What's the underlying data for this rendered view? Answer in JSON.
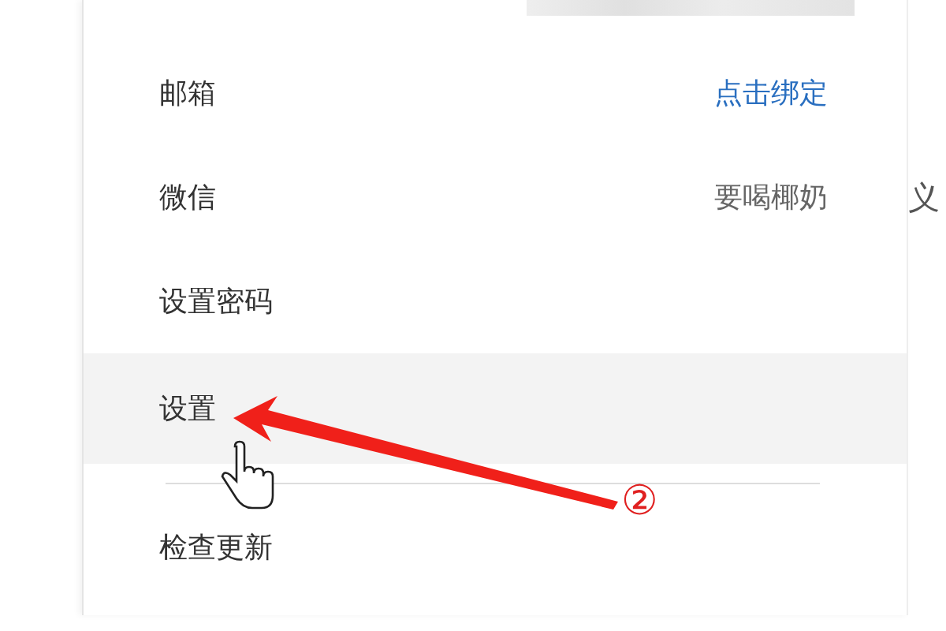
{
  "menu": {
    "items": [
      {
        "label": "邮箱",
        "value": "点击绑定",
        "kind": "link-value",
        "hovered": false,
        "divider_before": false
      },
      {
        "label": "微信",
        "value": "要喝椰奶",
        "kind": "text-value",
        "hovered": false,
        "divider_before": false
      },
      {
        "label": "设置密码",
        "kind": "plain",
        "hovered": false,
        "divider_before": false
      },
      {
        "label": "设置",
        "kind": "plain",
        "hovered": true,
        "divider_before": false
      },
      {
        "label": "检查更新",
        "kind": "plain",
        "hovered": false,
        "divider_before": true
      }
    ]
  },
  "annotation": {
    "step": "②"
  },
  "background": {
    "text": "义"
  }
}
